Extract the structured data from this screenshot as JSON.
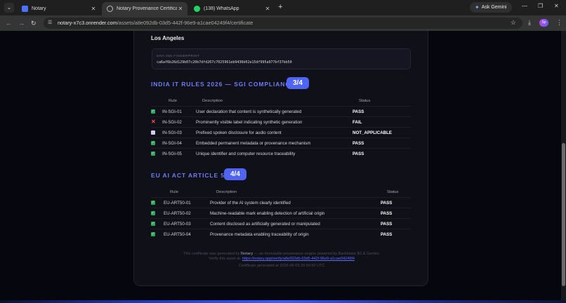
{
  "browser": {
    "tabs": [
      {
        "title": "Notary",
        "icon": "notary-logo-icon"
      },
      {
        "title": "Notary Provenance Certificate",
        "icon": "globe-icon",
        "active": true
      },
      {
        "title": "(138) WhatsApp",
        "icon": "whatsapp-icon"
      }
    ],
    "ask_gemini": "Ask Gemini",
    "url_host": "notary-x7c3.onrender.com",
    "url_path": "/assets/a8e092db-03d5-442f-96e9-a1cae04249f4/certificate",
    "profile_badge": "Sp"
  },
  "certificate": {
    "location": "Los Angeles",
    "hash_label": "SHA-256 FINGERPRINT",
    "hash_value": "ca6af6b26d129b07c20b7dfd267c7025961eb9436b02e15df995a977bf37bb50",
    "sections": [
      {
        "title": "INDIA IT RULES 2026 — SGI COMPLIANCE",
        "badge": "3/4",
        "headers": {
          "rule": "Rule",
          "description": "Description",
          "status": "Status"
        },
        "rows": [
          {
            "status_icon": "pass",
            "rule": "IN-SGI-01",
            "description": "User declaration that content is synthetically generated",
            "status": "PASS"
          },
          {
            "status_icon": "fail",
            "rule": "IN-SGI-02",
            "description": "Prominently visible label indicating synthetic generation",
            "status": "FAIL"
          },
          {
            "status_icon": "na",
            "rule": "IN-SGI-03",
            "description": "Prefixed spoken disclosure for audio content",
            "status": "NOT_APPLICABLE"
          },
          {
            "status_icon": "pass",
            "rule": "IN-SGI-04",
            "description": "Embedded permanent metadata or provenance mechanism",
            "status": "PASS"
          },
          {
            "status_icon": "pass",
            "rule": "IN-SGI-05",
            "description": "Unique identifier and computer resource traceability",
            "status": "PASS"
          }
        ]
      },
      {
        "title": "EU AI ACT ARTICLE 50",
        "badge": "4/4",
        "headers": {
          "rule": "Rule",
          "description": "Description",
          "status": "Status"
        },
        "rows": [
          {
            "status_icon": "pass",
            "rule": "EU-ART50-01",
            "description": "Provider of the AI system clearly identified",
            "status": "PASS"
          },
          {
            "status_icon": "pass",
            "rule": "EU-ART50-02",
            "description": "Machine-readable mark enabling detection of artificial origin",
            "status": "PASS"
          },
          {
            "status_icon": "pass",
            "rule": "EU-ART50-03",
            "description": "Content disclosed as artificially generated or manipulated",
            "status": "PASS"
          },
          {
            "status_icon": "pass",
            "rule": "EU-ART50-04",
            "description": "Provenance metadata enabling traceability of origin",
            "status": "PASS"
          }
        ]
      }
    ],
    "footer": {
      "line1_pre": "This certificate was generated by",
      "brand": "Notary",
      "line1_post": "— an immutable provenance engine powered by Backblaze B2 & Gemini.",
      "verify_text": "Verify this asset at:",
      "verify_url": "https://notary.app/verify/a8e092db-03d5-442f-96e9-a1cae04249f4",
      "generated": "Certificate generated at 2026-05-03 20:50:50 UTC"
    }
  }
}
